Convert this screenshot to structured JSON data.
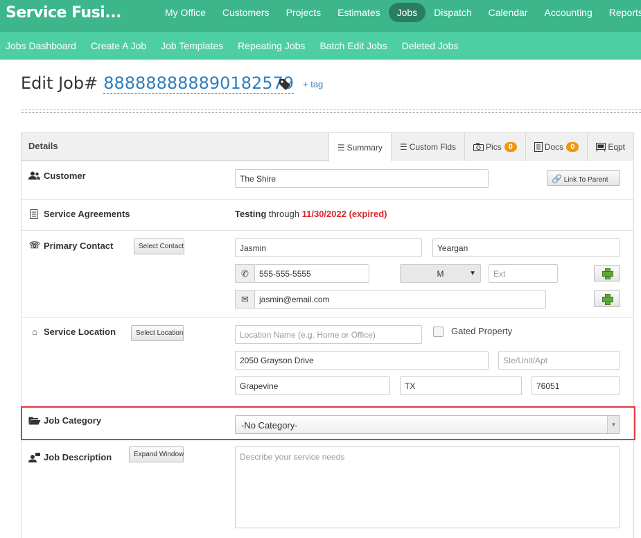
{
  "brand": "Service Fusi...",
  "topnav": [
    "My Office",
    "Customers",
    "Projects",
    "Estimates",
    "Jobs",
    "Dispatch",
    "Calendar",
    "Accounting",
    "Reports"
  ],
  "subnav": [
    "Jobs Dashboard",
    "Create A Job",
    "Job Templates",
    "Repeating Jobs",
    "Batch Edit Jobs",
    "Deleted Jobs"
  ],
  "page": {
    "title_label": "Edit Job#",
    "job_number": "888888888890182579",
    "tag_link": "+ tag"
  },
  "panel": {
    "heading": "Details",
    "tabs": {
      "summary": "Summary",
      "custom": "Custom Flds",
      "pics": "Pics",
      "pics_count": "0",
      "docs": "Docs",
      "docs_count": "0",
      "eqpt": "Eqpt"
    }
  },
  "customer": {
    "label": "Customer",
    "value": "The Shire",
    "link_button": "Link To Parent"
  },
  "agreements": {
    "label": "Service Agreements",
    "name": "Testing",
    "through": "through",
    "date": "11/30/2022",
    "status": "(expired)"
  },
  "contact": {
    "label": "Primary Contact",
    "select_button": "Select Contact",
    "first_name": "Jasmin",
    "last_name": "Yeargan",
    "phone": "555-555-5555",
    "phone_type": "M",
    "ext_placeholder": "Ext",
    "email": "jasmin@email.com"
  },
  "location": {
    "label": "Service Location",
    "select_button": "Select Location",
    "name_placeholder": "Location Name (e.g. Home or Office)",
    "gated_label": "Gated Property",
    "street": "2050 Grayson Drive",
    "unit_placeholder": "Ste/Unit/Apt",
    "city": "Grapevine",
    "state": "TX",
    "zip": "76051"
  },
  "category": {
    "label": "Job Category",
    "value": "-No Category-"
  },
  "description": {
    "label": "Job Description",
    "expand_button": "Expand Window",
    "placeholder": "Describe your service needs"
  }
}
